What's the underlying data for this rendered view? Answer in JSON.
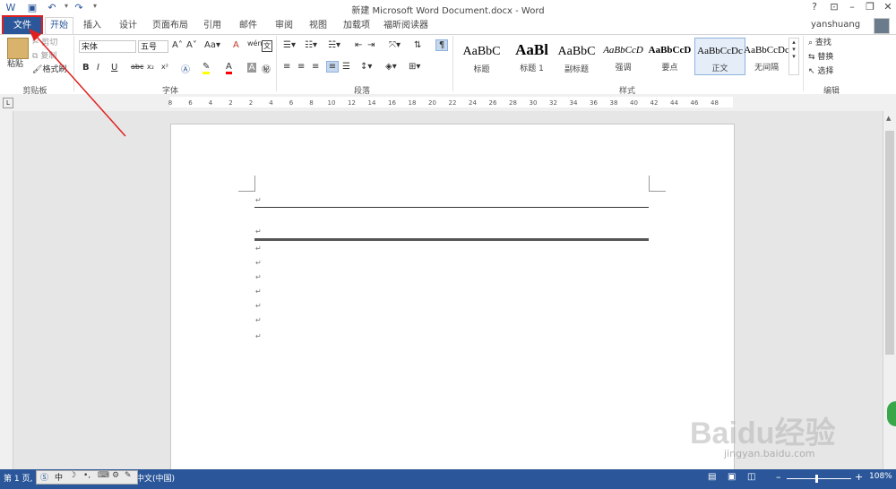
{
  "titlebar": {
    "title": "新建 Microsoft Word Document.docx - Word",
    "help": "?",
    "user": "yanshuang"
  },
  "tabs": {
    "file": "文件",
    "home": "开始",
    "insert": "插入",
    "design": "设计",
    "layout": "页面布局",
    "references": "引用",
    "mailings": "邮件",
    "review": "审阅",
    "view": "视图",
    "addins": "加载项",
    "foxit": "福昕阅读器"
  },
  "clipboard": {
    "paste": "粘贴",
    "cut": "剪切",
    "copy": "复制",
    "format_painter": "格式刷",
    "group": "剪贴板"
  },
  "font": {
    "name": "宋体",
    "size": "五号",
    "group": "字体"
  },
  "paragraph": {
    "group": "段落"
  },
  "styles": {
    "items": [
      {
        "sample": "AaBbC",
        "label": "标题"
      },
      {
        "sample": "AaBl",
        "label": "标题 1"
      },
      {
        "sample": "AaBbC",
        "label": "副标题"
      },
      {
        "sample": "AaBbCcD",
        "label": "强调"
      },
      {
        "sample": "AaBbCcD",
        "label": "要点"
      },
      {
        "sample": "AaBbCcDc",
        "label": "正文"
      },
      {
        "sample": "AaBbCcDc",
        "label": "无间隔"
      }
    ],
    "group": "样式"
  },
  "editing": {
    "find": "查找",
    "replace": "替换",
    "select": "选择",
    "group": "编辑"
  },
  "ruler": {
    "ticks": [
      "8",
      "6",
      "4",
      "2",
      "2",
      "4",
      "6",
      "8",
      "10",
      "12",
      "14",
      "16",
      "18",
      "20",
      "22",
      "24",
      "26",
      "28",
      "30",
      "32",
      "34",
      "36",
      "38",
      "40",
      "42",
      "44",
      "46",
      "48"
    ]
  },
  "document": {
    "para_mark": "↵"
  },
  "statusbar": {
    "page": "第 1 页,",
    "lang": "中文(中国)",
    "zoom": "108%",
    "ime_label": "中"
  },
  "watermark": {
    "text": "Baidu经验",
    "url": "jingyan.baidu.com"
  },
  "colors": {
    "accent": "#2b579a",
    "annotation": "#e02020"
  }
}
